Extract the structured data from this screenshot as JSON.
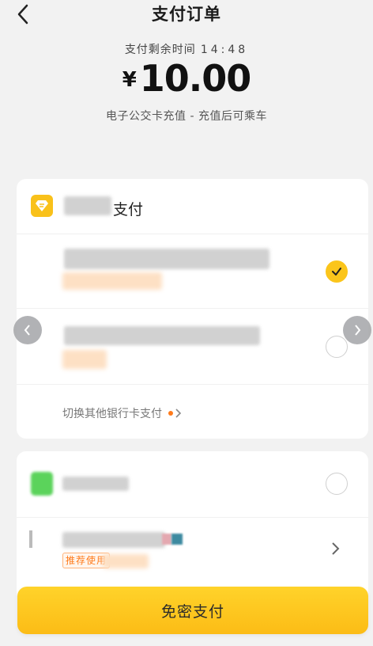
{
  "header": {
    "title": "支付订单",
    "back_icon": "chevron-left-icon"
  },
  "order": {
    "timer_label": "支付剩余时间",
    "timer_value": "14:48",
    "currency": "¥",
    "amount": "10.00",
    "description": "电子公交卡充值 - 充值后可乘车"
  },
  "card_pay": {
    "label_suffix": "支付",
    "switch_label": "切换其他银行卡支付",
    "options": [
      {
        "selected": true
      },
      {
        "selected": false
      }
    ]
  },
  "other_pay": {
    "options": [
      {
        "selected": false
      }
    ],
    "recommend_tag": "推荐使用"
  },
  "bottom": {
    "pay_button_label": "免密支付"
  },
  "colors": {
    "accent": "#fbc51b",
    "background": "#f2f2f2",
    "tag_orange": "#ff7a1a"
  }
}
